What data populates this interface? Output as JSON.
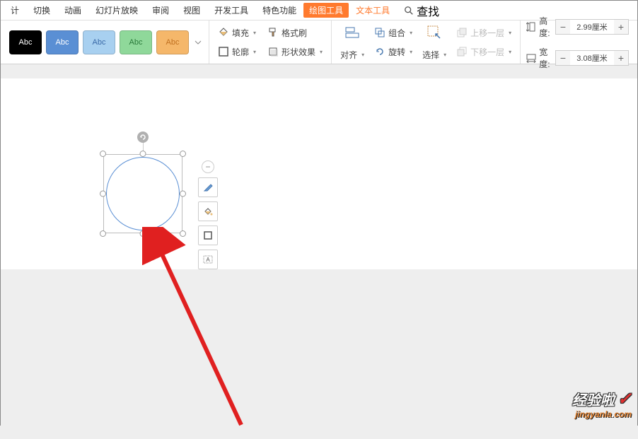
{
  "menu": {
    "items": [
      "计",
      "切换",
      "动画",
      "幻灯片放映",
      "审阅",
      "视图",
      "开发工具",
      "特色功能"
    ],
    "drawing_tools": "绘图工具",
    "text_tools": "文本工具",
    "search": "查找"
  },
  "styles": {
    "swatches": [
      "Abc",
      "Abc",
      "Abc",
      "Abc",
      "Abc"
    ]
  },
  "fill_group": {
    "fill": "填充",
    "format_painter": "格式刷",
    "outline": "轮廓",
    "shape_effects": "形状效果"
  },
  "arrange_group": {
    "align": "对齐",
    "group": "组合",
    "rotate": "旋转",
    "select": "选择",
    "move_up": "上移一层",
    "move_down": "下移一层"
  },
  "size_group": {
    "height_label": "高度:",
    "width_label": "宽度:",
    "height_value": "2.99厘米",
    "width_value": "3.08厘米"
  },
  "context_toolbar": {
    "collapse": "−"
  },
  "watermark": {
    "brand": "经验啦",
    "domain_pre": "jingyanla",
    "domain_dot": ".",
    "domain_suf": "com"
  }
}
